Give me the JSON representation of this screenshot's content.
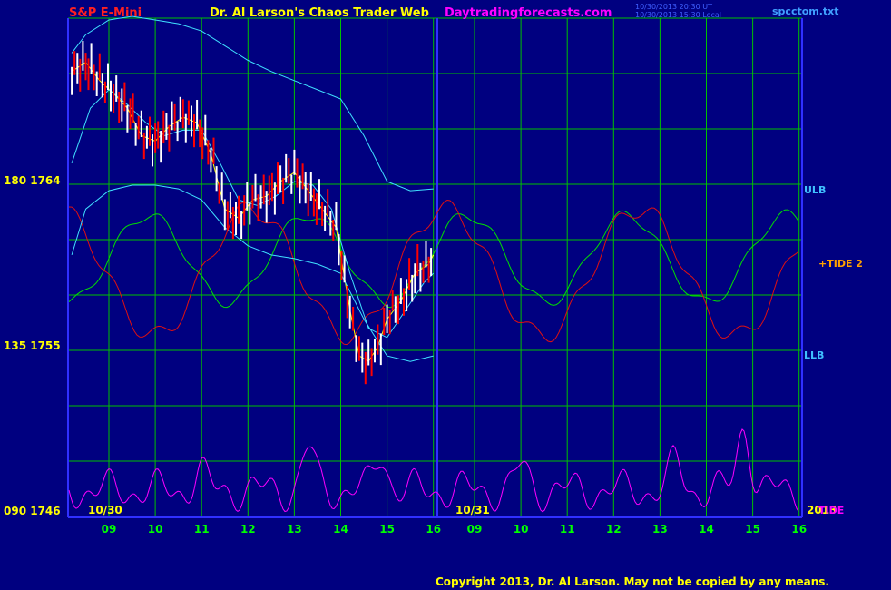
{
  "header": {
    "symbol": "S&P E-Mini",
    "title": "Dr. Al Larson's Chaos Trader Web",
    "site": "Daytradingforecasts.com",
    "timestamp_line1": "10/30/2013 20:30 UT",
    "timestamp_line2": "10/30/2013 15:30 Local",
    "file": "spcctom.txt"
  },
  "footer": {
    "copyright": "Copyright 2013, Dr. Al Larson. May not be copied by any means."
  },
  "colors": {
    "background": "#000080",
    "grid": "#00c000",
    "divider": "#3030ff",
    "symbol": "#ff2020",
    "title": "#ffff00",
    "site": "#ff00ff",
    "timestamp": "#4060ff",
    "file": "#40a0ff",
    "price_up": "#ffffff",
    "price_down": "#ff0000",
    "ma": "#ffff00",
    "bands": "#40e0ff",
    "green_wave": "#00e000",
    "red_wave": "#e01010",
    "magenta_tide": "#ff00ff",
    "ylabels": "#ffff00",
    "xlabels": "#00ff00",
    "band_labels": "#40c0ff",
    "copyright": "#ffff00"
  },
  "chart_data": {
    "type": "line",
    "title": "S&P E-Mini",
    "xlabel": "",
    "ylabel": "",
    "y_tick_labels": [
      "180 1764",
      "135 1755",
      "090 1746"
    ],
    "y_ticks_price": [
      1764,
      1755,
      1746
    ],
    "ylim": [
      1746,
      1772
    ],
    "x_hours": [
      9,
      10,
      11,
      12,
      13,
      14,
      15,
      16,
      9,
      10,
      11,
      12,
      13,
      14,
      15,
      16
    ],
    "x_tick_labels": [
      "09",
      "10",
      "11",
      "12",
      "13",
      "14",
      "15",
      "16",
      "09",
      "10",
      "11",
      "12",
      "13",
      "14",
      "15",
      "16"
    ],
    "date_labels": [
      "10/30",
      "10/31",
      "2013"
    ],
    "band_labels": [
      "ULB",
      "LLB"
    ],
    "right_labels": [
      "+TIDE 2",
      "TIDE"
    ],
    "grid": true,
    "series": [
      {
        "name": "",
        "x": [
          8.2,
          8.5,
          8.8,
          9.1,
          9.4,
          9.7,
          10.0,
          10.3,
          10.6,
          10.9,
          11.2,
          11.5,
          11.8,
          12.1,
          12.4,
          12.7,
          13.0,
          13.3,
          13.6,
          13.9,
          14.2,
          14.4,
          14.6,
          14.8,
          15.0,
          15.3,
          15.6,
          15.9,
          16.0
        ],
        "y": [
          1770,
          1770.5,
          1769.5,
          1768.8,
          1768,
          1766.5,
          1766.2,
          1767,
          1767.5,
          1767.2,
          1765.5,
          1762.5,
          1762,
          1763,
          1763.2,
          1764,
          1764.5,
          1763.5,
          1762.5,
          1761.5,
          1757,
          1754.5,
          1754.2,
          1755,
          1756.5,
          1757.5,
          1759,
          1759.5,
          1760
        ]
      },
      {
        "name": "",
        "x": [
          8.2,
          8.6,
          9.0,
          9.4,
          9.8,
          10.2,
          10.6,
          11.0,
          11.4,
          11.8,
          12.2,
          12.6,
          13.0,
          13.4,
          13.8,
          14.2,
          14.6,
          15.0,
          15.4,
          15.8,
          16.0
        ],
        "y": [
          1765,
          1768,
          1769,
          1768.2,
          1767.2,
          1766.5,
          1766.8,
          1766.8,
          1765,
          1763,
          1762.7,
          1763.2,
          1764,
          1763.8,
          1762.5,
          1759,
          1756,
          1755.5,
          1757,
          1758.5,
          1759
        ]
      },
      {
        "name": "ULB",
        "x": [
          8.2,
          8.5,
          9.0,
          9.5,
          10.0,
          10.5,
          11.0,
          11.5,
          12.0,
          12.5,
          13.0,
          13.5,
          14.0,
          14.5,
          15.0,
          15.5,
          16.0
        ],
        "y": [
          1771,
          1772,
          1772.8,
          1773,
          1772.8,
          1772.6,
          1772.2,
          1771.4,
          1770.6,
          1770,
          1769.5,
          1769,
          1768.5,
          1766.5,
          1764,
          1763.5,
          1763.6
        ]
      },
      {
        "name": "LLB",
        "x": [
          8.2,
          8.5,
          9.0,
          9.5,
          10.0,
          10.5,
          11.0,
          11.5,
          12.0,
          12.5,
          13.0,
          13.5,
          14.0,
          14.5,
          15.0,
          15.5,
          16.0
        ],
        "y": [
          1760,
          1762.5,
          1763.5,
          1763.8,
          1763.8,
          1763.6,
          1763,
          1761.5,
          1760.5,
          1760,
          1759.8,
          1759.5,
          1759,
          1756.5,
          1754.5,
          1754.2,
          1754.5
        ]
      }
    ]
  }
}
